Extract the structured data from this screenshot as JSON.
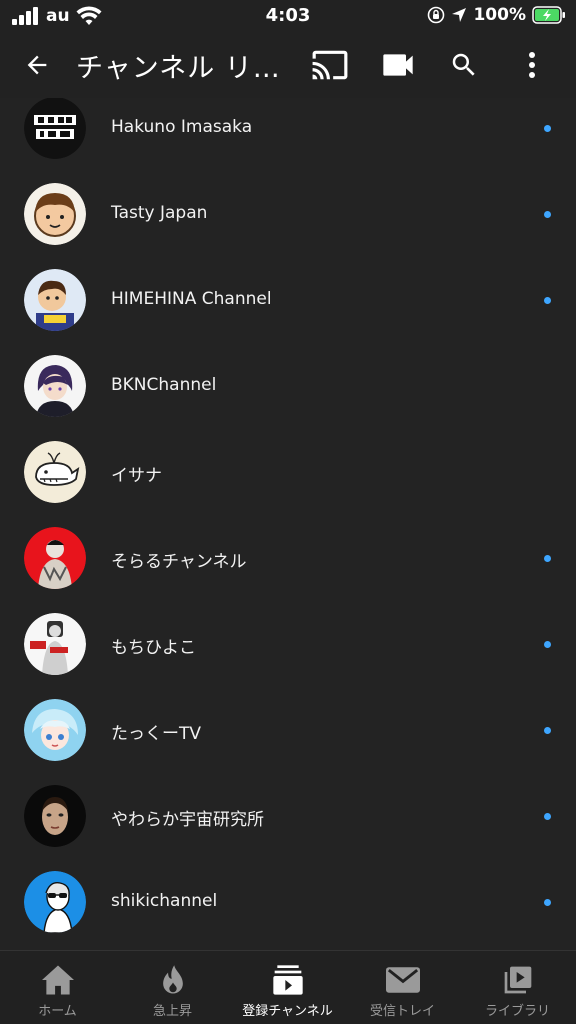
{
  "status_bar": {
    "carrier": "au",
    "time": "4:03",
    "battery": "100%"
  },
  "app_bar": {
    "title": "チャンネル リ…",
    "icons": [
      "back-arrow-icon",
      "cast-icon",
      "video-camera-icon",
      "search-icon",
      "more-vert-icon"
    ]
  },
  "channels": [
    {
      "name": "Hakuno Imasaka",
      "has_new": true,
      "avatar_bg": "#111111"
    },
    {
      "name": "Tasty Japan",
      "has_new": true,
      "avatar_bg": "#f4f0e8"
    },
    {
      "name": "HIMEHINA Channel",
      "has_new": true,
      "avatar_bg": "#dfe9f5"
    },
    {
      "name": "BKNChannel",
      "has_new": false,
      "avatar_bg": "#f5f5f5"
    },
    {
      "name": "イサナ",
      "has_new": false,
      "avatar_bg": "#f3ecd9"
    },
    {
      "name": "そらるチャンネル",
      "has_new": true,
      "avatar_bg": "#e8141c"
    },
    {
      "name": "もちひよこ",
      "has_new": true,
      "avatar_bg": "#f7f7f7"
    },
    {
      "name": "たっくーTV",
      "has_new": true,
      "avatar_bg": "#8fd3f0"
    },
    {
      "name": "やわらか宇宙研究所",
      "has_new": true,
      "avatar_bg": "#0a0a0a"
    },
    {
      "name": "shikichannel",
      "has_new": true,
      "avatar_bg": "#1c8fe6"
    }
  ],
  "bottom_nav": {
    "items": [
      {
        "label": "ホーム",
        "icon": "home-icon"
      },
      {
        "label": "急上昇",
        "icon": "flame-icon"
      },
      {
        "label": "登録チャンネル",
        "icon": "subscriptions-icon"
      },
      {
        "label": "受信トレイ",
        "icon": "mail-icon"
      },
      {
        "label": "ライブラリ",
        "icon": "library-icon"
      }
    ],
    "active": "登録チャンネル"
  },
  "colors": {
    "background": "#232323",
    "bar": "#222222",
    "new_dot": "#3ea6ff",
    "battery": "#4cd964"
  }
}
